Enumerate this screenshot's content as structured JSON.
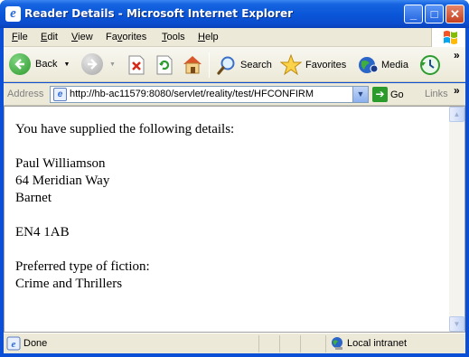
{
  "window": {
    "title": "Reader Details - Microsoft Internet Explorer",
    "minimize_glyph": "_",
    "maximize_glyph": "□",
    "close_glyph": "✕"
  },
  "menubar": {
    "items": [
      {
        "key": "F",
        "rest": "ile"
      },
      {
        "key": "E",
        "rest": "dit"
      },
      {
        "key": "V",
        "rest": "iew"
      },
      {
        "key": "",
        "rest": "Favorites",
        "underline_index": 2
      },
      {
        "key": "T",
        "rest": "ools"
      },
      {
        "key": "H",
        "rest": "elp"
      }
    ]
  },
  "toolbar": {
    "back_label": "Back",
    "search_label": "Search",
    "favorites_label": "Favorites",
    "media_label": "Media",
    "overflow_glyph": "»",
    "icons": [
      "back-icon",
      "forward-icon",
      "stop-icon",
      "refresh-icon",
      "home-icon",
      "search-icon",
      "favorites-star-icon",
      "media-icon",
      "history-icon"
    ]
  },
  "addressbar": {
    "label": "Address",
    "url": "http://hb-ac11579:8080/servlet/reality/test/HFCONFIRM",
    "go_label": "Go",
    "links_label": "Links",
    "overflow_glyph": "»"
  },
  "document": {
    "intro": "You have supplied the following details:",
    "name": "Paul Williamson",
    "address_line1": "64 Meridian Way",
    "address_line2": "Barnet",
    "address_line3": "",
    "postcode": "EN4 1AB",
    "fiction_label": "Preferred type of fiction:",
    "fiction_value": "Crime and Thrillers"
  },
  "statusbar": {
    "status": "Done",
    "zone": "Local intranet"
  },
  "colors": {
    "titlebar": "#0a55d8",
    "chrome": "#ece9d8",
    "go_green": "#2b9c2b",
    "back_green": "#2e9b2e"
  }
}
